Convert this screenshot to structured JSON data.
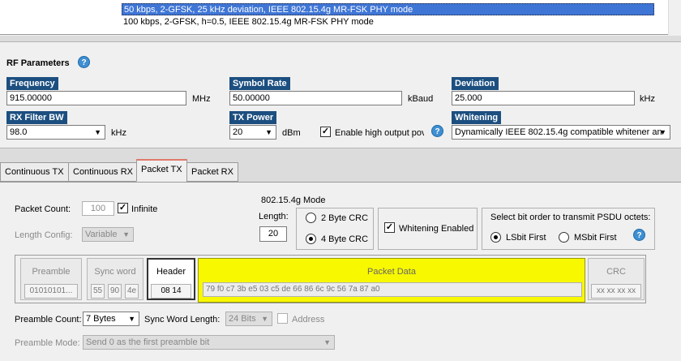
{
  "phy_list": {
    "items": [
      "50 kbps, 2-GFSK, 25 kHz deviation, IEEE 802.15.4g MR-FSK PHY mode",
      "100 kbps, 2-GFSK, h=0.5, IEEE 802.15.4g MR-FSK PHY mode"
    ],
    "selected_index": 0
  },
  "rf": {
    "title": "RF Parameters",
    "frequency": {
      "label": "Frequency",
      "value": "915.00000",
      "unit": "MHz"
    },
    "symbol_rate": {
      "label": "Symbol Rate",
      "value": "50.00000",
      "unit": "kBaud"
    },
    "deviation": {
      "label": "Deviation",
      "value": "25.000",
      "unit": "kHz"
    },
    "rx_filter_bw": {
      "label": "RX Filter BW",
      "value": "98.0",
      "unit": "kHz"
    },
    "tx_power": {
      "label": "TX Power",
      "value": "20",
      "unit": "dBm"
    },
    "high_output": {
      "label": "Enable high output pov",
      "checked": true
    },
    "whitening": {
      "label": "Whitening",
      "value": "Dynamically IEEE 802.15.4g compatible whitener an"
    }
  },
  "tabs": [
    {
      "label": "Continuous TX",
      "active": false
    },
    {
      "label": "Continuous RX",
      "active": false
    },
    {
      "label": "Packet TX",
      "active": true
    },
    {
      "label": "Packet RX",
      "active": false
    }
  ],
  "packet_tx": {
    "packet_count": {
      "label": "Packet Count:",
      "value": "100"
    },
    "infinite": {
      "label": "Infinite",
      "checked": true
    },
    "length_config": {
      "label": "Length Config:",
      "value": "Variable"
    },
    "mode_title": "802.15.4g Mode",
    "length": {
      "label": "Length:",
      "value": "20"
    },
    "crc_options": [
      {
        "label": "2 Byte CRC",
        "selected": false
      },
      {
        "label": "4 Byte CRC",
        "selected": true
      }
    ],
    "whitening_enabled": {
      "label": "Whitening Enabled",
      "checked": true
    },
    "bit_order": {
      "title": "Select bit order to transmit PSDU octets:",
      "options": [
        {
          "label": "LSbit First",
          "selected": true
        },
        {
          "label": "MSbit First",
          "selected": false
        }
      ]
    },
    "frame": {
      "preamble": {
        "title": "Preamble",
        "value": "01010101..."
      },
      "sync_word": {
        "title": "Sync word",
        "bytes": [
          "55",
          "90",
          "4e"
        ]
      },
      "header": {
        "title": "Header",
        "value": "08 14"
      },
      "payload": {
        "title": "Packet Data",
        "value": "79 f0 c7 3b e5 03 c5 de 66 86 6c 9c 56 7a 87 a0"
      },
      "crc": {
        "title": "CRC",
        "value": "xx xx xx xx"
      }
    },
    "preamble_count": {
      "label": "Preamble Count:",
      "value": "7 Bytes"
    },
    "sync_word_length": {
      "label": "Sync Word Length:",
      "value": "24 Bits"
    },
    "address": {
      "label": "Address",
      "checked": false
    },
    "preamble_mode": {
      "label": "Preamble Mode:",
      "value": "Send 0 as the first preamble bit"
    }
  },
  "icons": {
    "help": "help-circle-icon",
    "dropdown": "chevron-down-icon",
    "check": "checkmark-icon"
  },
  "colors": {
    "selection": "#3f76d6",
    "label_tag": "#1c4f80",
    "help_icon": "#3f8fd2",
    "payload": "#f8f800",
    "active_tab_accent": "#e07a6a"
  }
}
